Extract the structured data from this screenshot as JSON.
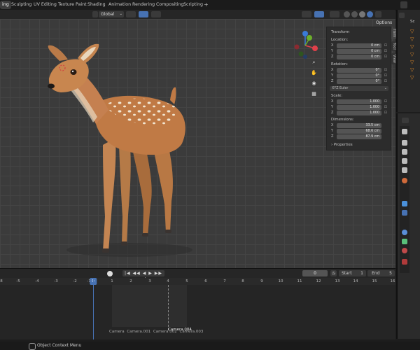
{
  "menu": {
    "tabs": [
      "ing",
      "Sculpting",
      "UV Editing",
      "Texture Paint",
      "Shading",
      "Animation",
      "Rendering",
      "Compositing",
      "Scripting"
    ],
    "add_tab": "+",
    "active_index": 0
  },
  "viewport_header": {
    "orientation": "Global",
    "options_label": "Options"
  },
  "gizmo": {
    "z": "Z",
    "y": "Y",
    "x": "X"
  },
  "npanel": {
    "tabs": [
      "Item",
      "Tool",
      "View"
    ],
    "transform_title": "Transform",
    "location_label": "Location:",
    "location": [
      {
        "axis": "X",
        "value": "0 cm"
      },
      {
        "axis": "Y",
        "value": "0 cm"
      },
      {
        "axis": "Z",
        "value": "0 cm"
      }
    ],
    "rotation_label": "Rotation:",
    "rotation": [
      {
        "axis": "X",
        "value": "0°"
      },
      {
        "axis": "Y",
        "value": "0°"
      },
      {
        "axis": "Z",
        "value": "0°"
      }
    ],
    "rotation_mode": "XYZ Euler",
    "scale_label": "Scale:",
    "scale": [
      {
        "axis": "X",
        "value": "1.000"
      },
      {
        "axis": "Y",
        "value": "1.000"
      },
      {
        "axis": "Z",
        "value": "1.000"
      }
    ],
    "dimensions_label": "Dimensions:",
    "dimensions": [
      {
        "axis": "X",
        "value": "33.5 cm"
      },
      {
        "axis": "Y",
        "value": "68.6 cm"
      },
      {
        "axis": "Z",
        "value": "87.9 cm"
      }
    ],
    "properties_title": "Properties"
  },
  "timeline": {
    "current_frame": "0",
    "start_label": "Start",
    "start_value": "1",
    "end_label": "End",
    "end_value": "5",
    "ruler": [
      "8",
      "-5",
      "-4",
      "-3",
      "-2",
      "-1",
      "0",
      "1",
      "2",
      "3",
      "4",
      "5",
      "6",
      "7",
      "8",
      "9",
      "10",
      "11",
      "12",
      "13",
      "14",
      "15",
      "16"
    ],
    "markers": [
      "Camera",
      "Camera.001",
      "Camera.002",
      "Camera.004",
      "Camera.003"
    ]
  },
  "outliner": {
    "header_text": "Sc"
  },
  "statusbar": {
    "text": "Object Context Menu"
  },
  "colors": {
    "accent": "#4772b3",
    "viewport": "#3b3b3b",
    "gizmo_x": "#e0404a",
    "gizmo_y": "#6cae2b",
    "gizmo_z": "#3a7ad8",
    "fawn_body": "#c07a45",
    "fawn_spots": "#f2e6d2"
  }
}
